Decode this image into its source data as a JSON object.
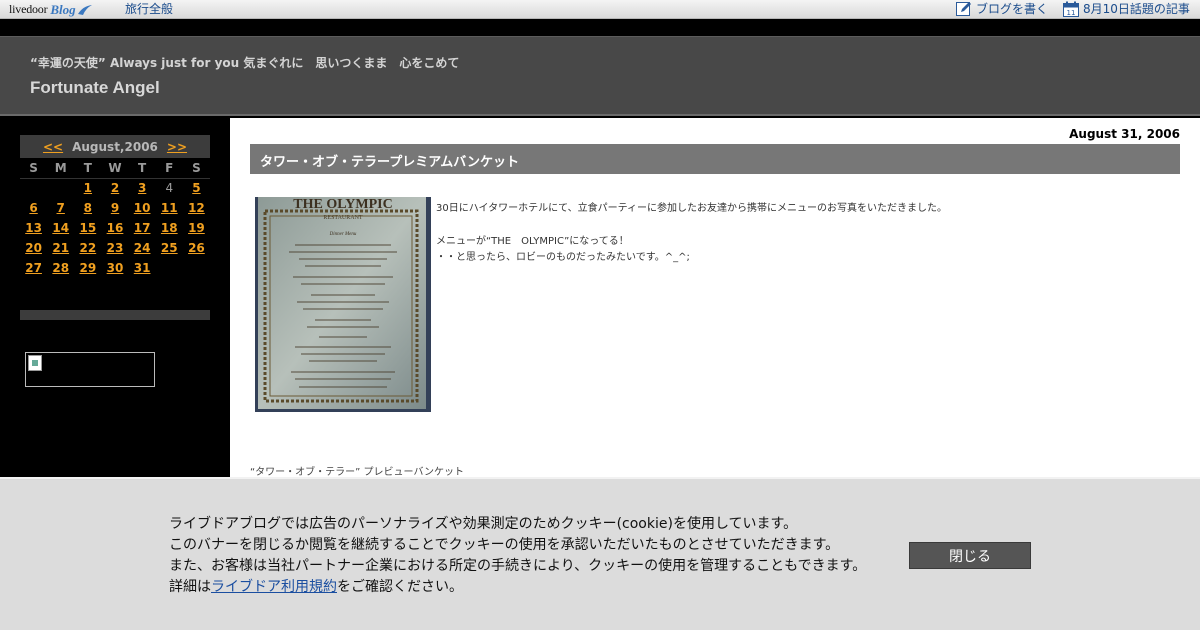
{
  "topbar": {
    "logo_text": "livedoor",
    "logo_blog": "Blog",
    "category_link": "旅行全般",
    "write_link": "ブログを書く",
    "topic_link": "8月10日話題の記事",
    "calendar_icon_day": "11"
  },
  "header": {
    "tagline": "“幸運の天使” Always just for you 気まぐれに　思いつくまま　心をこめて",
    "title": "Fortunate Angel"
  },
  "sidebar": {
    "calendar": {
      "prev": "<<",
      "month": "August,2006",
      "next": ">>",
      "weekdays": [
        "S",
        "M",
        "T",
        "W",
        "T",
        "F",
        "S"
      ],
      "weeks": [
        [
          "",
          "",
          "1",
          "2",
          "3",
          "4",
          "5"
        ],
        [
          "6",
          "7",
          "8",
          "9",
          "10",
          "11",
          "12"
        ],
        [
          "13",
          "14",
          "15",
          "16",
          "17",
          "18",
          "19"
        ],
        [
          "20",
          "21",
          "22",
          "23",
          "24",
          "25",
          "26"
        ],
        [
          "27",
          "28",
          "29",
          "30",
          "31",
          "",
          ""
        ]
      ],
      "unlinked_days": [
        "4"
      ]
    }
  },
  "post": {
    "date": "August 31, 2006",
    "title": "タワー・オブ・テラープレミアムバンケット",
    "photo": {
      "heading": "THE OLYMPIC",
      "subheading": "RESTAURANT",
      "menu_heading": "Dinner Menu"
    },
    "body": [
      "30日にハイタワーホテルにて、立食パーティーに参加したお友達から携帯にメニューのお写真をいただきました。",
      "メニューが“THE　OLYMPIC”になってる！",
      "・・と思ったら、ロビーのものだったみたいです。^_^;"
    ],
    "next_post": "“タワー・オブ・テラー” プレビューバンケット"
  },
  "cookie": {
    "lines": [
      "ライブドアブログでは広告のパーソナライズや効果測定のためクッキー(cookie)を使用しています。",
      "このバナーを閉じるか閲覧を継続することでクッキーの使用を承認いただいたものとさせていただきます。",
      "また、お客様は当社パートナー企業における所定の手続きにより、クッキーの使用を管理することもできます。"
    ],
    "detail_prefix": "詳細は",
    "detail_link": "ライブドア利用規約",
    "detail_suffix": "をご確認ください。",
    "close_label": "閉じる"
  },
  "colors": {
    "accent_orange": "#f0a020",
    "link_blue": "#1b4c8c",
    "header_bg": "#484848",
    "title_bar_bg": "#777777"
  }
}
